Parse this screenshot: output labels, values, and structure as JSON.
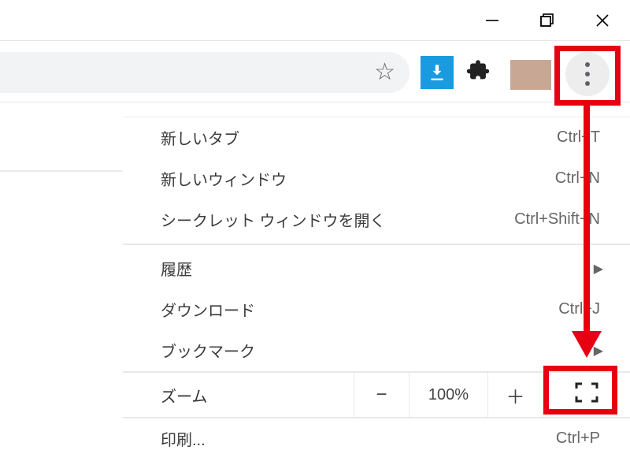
{
  "window_controls": {
    "minimize": "−",
    "maximize": "❐",
    "close": "×"
  },
  "toolbar": {
    "star_label": "☆",
    "download_ext": "download-arrow",
    "extensions_label": "🧩",
    "more_label": "⋮"
  },
  "menu": {
    "new_tab": {
      "label": "新しいタブ",
      "shortcut": "Ctrl+T"
    },
    "new_window": {
      "label": "新しいウィンドウ",
      "shortcut": "Ctrl+N"
    },
    "incognito": {
      "label": "シークレット ウィンドウを開く",
      "shortcut": "Ctrl+Shift+N"
    },
    "history": {
      "label": "履歴"
    },
    "downloads": {
      "label": "ダウンロード",
      "shortcut": "Ctrl+J"
    },
    "bookmarks": {
      "label": "ブックマーク"
    },
    "zoom": {
      "label": "ズーム",
      "minus": "−",
      "value": "100%",
      "plus": "＋"
    },
    "print": {
      "label": "印刷...",
      "shortcut": "Ctrl+P"
    }
  },
  "annotation": {
    "highlight_color": "#e60012"
  }
}
